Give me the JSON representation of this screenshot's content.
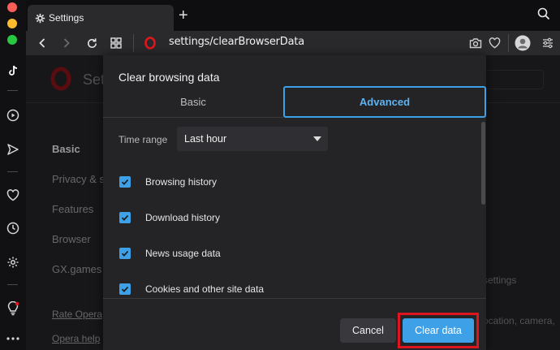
{
  "window": {
    "tab_title": "Settings",
    "tab_icon": "gear-icon"
  },
  "toolbar": {
    "url_scheme": "settings",
    "url_path": "/clearBrowserData"
  },
  "settings_page": {
    "title": "Sett",
    "nav": [
      "Basic",
      "Privacy & s",
      "Features",
      "Browser",
      "GX.games"
    ],
    "links": [
      "Rate Opera",
      "Opera help"
    ],
    "bg_texts": [
      "settings",
      "ocation, camera,"
    ]
  },
  "dialog": {
    "title": "Clear browsing data",
    "tabs": {
      "basic": "Basic",
      "advanced": "Advanced"
    },
    "time_range_label": "Time range",
    "time_range_value": "Last hour",
    "checkboxes": [
      {
        "label": "Browsing history",
        "checked": true
      },
      {
        "label": "Download history",
        "checked": true
      },
      {
        "label": "News usage data",
        "checked": true
      },
      {
        "label": "Cookies and other site data",
        "checked": true
      }
    ],
    "cancel_label": "Cancel",
    "clear_label": "Clear data"
  },
  "colors": {
    "accent": "#3ea1e8",
    "highlight": "#e0141e",
    "opera_red": "#e0171d"
  }
}
